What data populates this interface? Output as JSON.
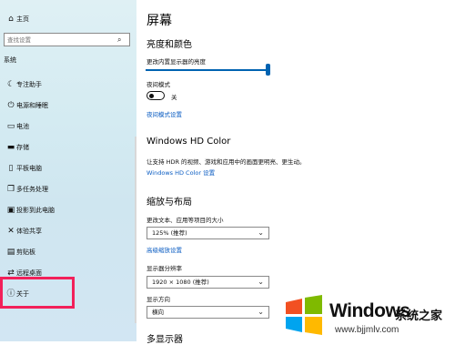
{
  "sidebar": {
    "home": "主页",
    "search_placeholder": "查找设置",
    "section": "系统",
    "items": [
      {
        "label": "专注助手",
        "icon": "moon-icon"
      },
      {
        "label": "电源和睡眠",
        "icon": "power-icon"
      },
      {
        "label": "电池",
        "icon": "battery-icon"
      },
      {
        "label": "存储",
        "icon": "storage-icon"
      },
      {
        "label": "平板电脑",
        "icon": "tablet-icon"
      },
      {
        "label": "多任务处理",
        "icon": "multitask-icon"
      },
      {
        "label": "投影到此电脑",
        "icon": "project-icon"
      },
      {
        "label": "体验共享",
        "icon": "share-icon"
      },
      {
        "label": "剪贴板",
        "icon": "clipboard-icon"
      },
      {
        "label": "远程桌面",
        "icon": "remote-icon"
      },
      {
        "label": "关于",
        "icon": "info-icon"
      }
    ]
  },
  "main": {
    "title": "屏幕",
    "brightness_heading": "亮度和颜色",
    "brightness_label": "更改内置显示器的亮度",
    "brightness_level": 1.0,
    "night_light_label": "夜间模式",
    "night_light_state": "关",
    "night_light_link": "夜间模式设置",
    "hdr_heading": "Windows HD Color",
    "hdr_desc": "让支持 HDR 的视频、游戏和应用中的画面更明亮、更生动。",
    "hdr_link": "Windows HD Color 设置",
    "scale_heading": "缩放与布局",
    "scale_label": "更改文本、应用等项目的大小",
    "scale_value": "125% (推荐)",
    "advanced_scale_link": "高级缩放设置",
    "resolution_label": "显示器分辨率",
    "resolution_value": "1920 × 1080 (推荐)",
    "orientation_label": "显示方向",
    "orientation_value": "横向",
    "multi_display_heading": "多显示器"
  },
  "watermark": {
    "brand": "Windows",
    "sub": "系统之家",
    "url": "www.bjjmlv.com"
  }
}
